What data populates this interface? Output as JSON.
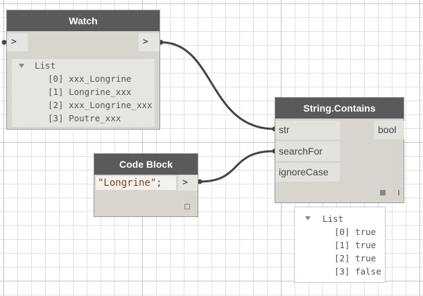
{
  "watch_node": {
    "title": "Watch",
    "input_port": ">",
    "output_port": ">",
    "list_label": "List",
    "items": [
      {
        "index": "[0]",
        "value": "xxx_Longrine"
      },
      {
        "index": "[1]",
        "value": "Longrine_xxx"
      },
      {
        "index": "[2]",
        "value": "xxx_Longrine_xxx"
      },
      {
        "index": "[3]",
        "value": "Poutre_xxx"
      }
    ]
  },
  "code_block_node": {
    "title": "Code Block",
    "code": "\"Longrine\";",
    "output_port": ">"
  },
  "string_contains_node": {
    "title": "String.Contains",
    "inputs": [
      "str",
      "searchFor",
      "ignoreCase"
    ],
    "output": "bool"
  },
  "result_preview": {
    "list_label": "List",
    "items": [
      {
        "index": "[0]",
        "value": "true"
      },
      {
        "index": "[1]",
        "value": "true"
      },
      {
        "index": "[2]",
        "value": "true"
      },
      {
        "index": "[3]",
        "value": "false"
      }
    ]
  },
  "colors": {
    "node_header": "#5a5a5a",
    "node_body": "#d8d5cf",
    "wire": "#444444",
    "code_string": "#8b3a1a",
    "grid_major": "#c4c4c4",
    "grid_minor": "#e2e2e2"
  }
}
